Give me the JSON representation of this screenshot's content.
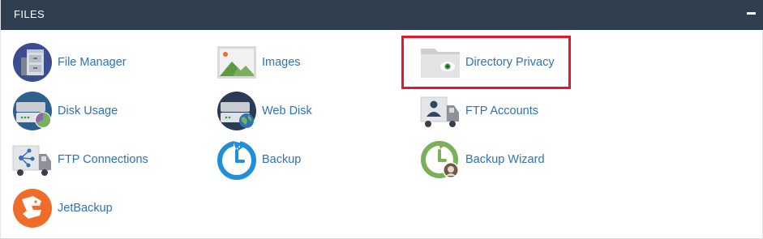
{
  "section": {
    "title": "FILES",
    "collapse_icon": "minus-icon"
  },
  "items": [
    {
      "label": "File Manager",
      "icon": "file-manager-icon"
    },
    {
      "label": "Images",
      "icon": "images-icon"
    },
    {
      "label": "Directory Privacy",
      "icon": "directory-privacy-icon",
      "highlighted": true
    },
    {
      "label": "Disk Usage",
      "icon": "disk-usage-icon"
    },
    {
      "label": "Web Disk",
      "icon": "web-disk-icon"
    },
    {
      "label": "FTP Accounts",
      "icon": "ftp-accounts-icon"
    },
    {
      "label": "FTP Connections",
      "icon": "ftp-connections-icon"
    },
    {
      "label": "Backup",
      "icon": "backup-icon"
    },
    {
      "label": "Backup Wizard",
      "icon": "backup-wizard-icon"
    },
    {
      "label": "JetBackup",
      "icon": "jetbackup-icon"
    }
  ],
  "colors": {
    "header_bg": "#2f3f4f",
    "link": "#2f72b5",
    "highlight_border": "#e5182b"
  }
}
